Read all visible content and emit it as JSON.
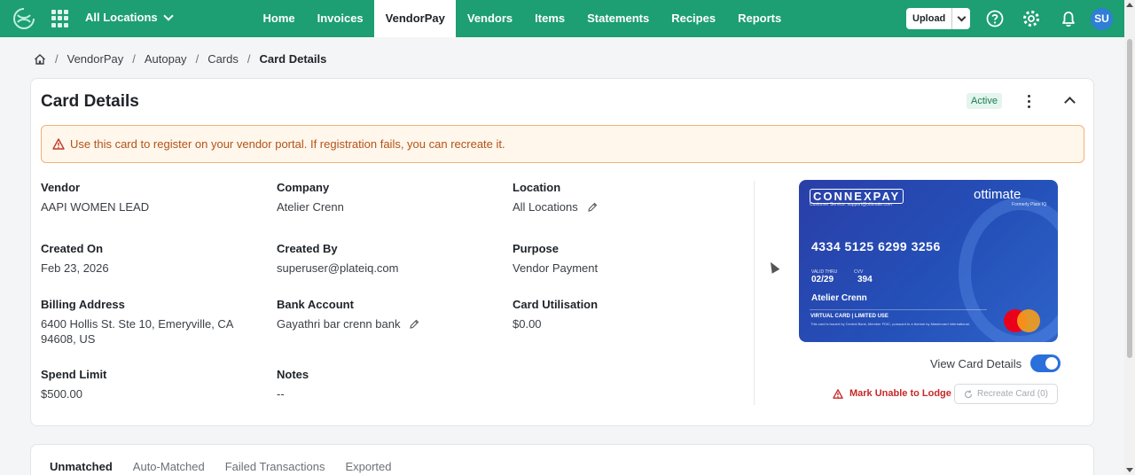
{
  "topbar": {
    "location_switcher": "All Locations",
    "nav": [
      "Home",
      "Invoices",
      "VendorPay",
      "Vendors",
      "Items",
      "Statements",
      "Recipes",
      "Reports"
    ],
    "active_nav": "VendorPay",
    "upload_label": "Upload",
    "avatar_initials": "SU",
    "brand_color": "#1d9e73"
  },
  "breadcrumb": [
    "VendorPay",
    "Autopay",
    "Cards",
    "Card Details"
  ],
  "card_details": {
    "title": "Card Details",
    "status": "Active",
    "alert": "Use this card to register on your vendor portal. If registration fails, you can recreate it.",
    "fields": {
      "vendor": {
        "label": "Vendor",
        "value": "AAPI WOMEN LEAD"
      },
      "company": {
        "label": "Company",
        "value": "Atelier Crenn"
      },
      "location": {
        "label": "Location",
        "value": "All Locations"
      },
      "created_on": {
        "label": "Created On",
        "value": "Feb 23, 2026"
      },
      "created_by": {
        "label": "Created By",
        "value": "superuser@plateiq.com"
      },
      "purpose": {
        "label": "Purpose",
        "value": "Vendor Payment"
      },
      "billing_address": {
        "label": "Billing Address",
        "value": "6400 Hollis St. Ste 10, Emeryville, CA 94608, US"
      },
      "bank_account": {
        "label": "Bank Account",
        "value": "Gayathri bar crenn bank"
      },
      "card_utilisation": {
        "label": "Card Utilisation",
        "value": "$0.00"
      },
      "spend_limit": {
        "label": "Spend Limit",
        "value": "$500.00"
      },
      "notes": {
        "label": "Notes",
        "value": "--"
      }
    },
    "card": {
      "issuer": "CONNEXPAY",
      "issuer_sub": "Customer Service: support@ottimate.com",
      "brand": "ottimate",
      "brand_sub": "Formerly Plate IQ",
      "number": "4334 5125 6299 3256",
      "valid_thru_label": "VALID THRU",
      "valid_thru": "02/29",
      "cvv_label": "CVV",
      "cvv": "394",
      "holder": "Atelier Crenn",
      "type_label": "VIRTUAL CARD | LIMITED USE",
      "fine_print": "This card is issued by Central Bank, Member FDIC, pursuant to a license by Mastercard International."
    },
    "view_card_details_label": "View Card Details",
    "view_card_details_on": true,
    "mark_unable_label": "Mark Unable to Lodge",
    "recreate_label": "Recreate Card (0)"
  },
  "tabs": [
    "Unmatched",
    "Auto-Matched",
    "Failed Transactions",
    "Exported"
  ],
  "active_tab": "Unmatched"
}
